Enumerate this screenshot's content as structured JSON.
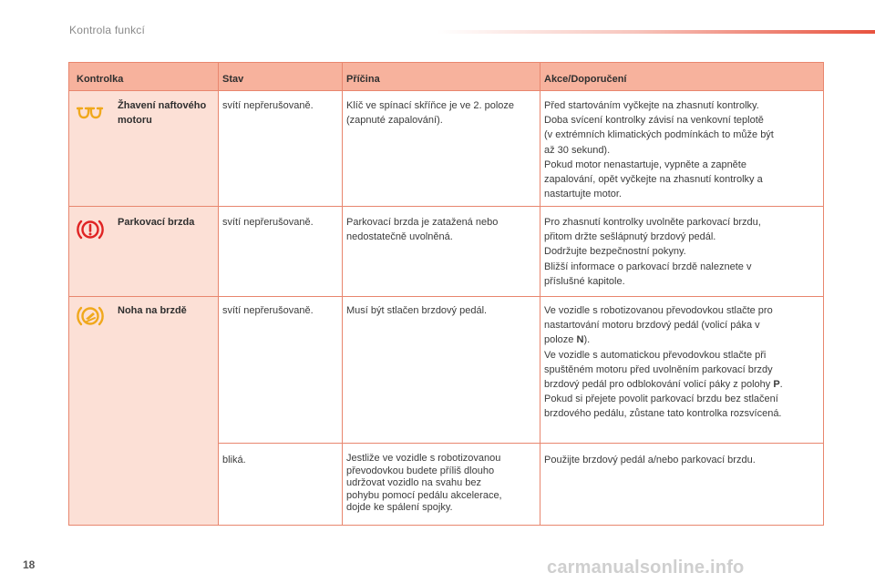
{
  "header": {
    "section_title": "Kontrola funkcí"
  },
  "table": {
    "headers": {
      "col1": "Kontrolka",
      "col2": "Stav",
      "col3": "Příčina",
      "col4": "Akce/Doporučení"
    },
    "rows": [
      {
        "icon": "glow-plug-icon",
        "name": "Žhavení naftového motoru",
        "state": "svítí nepřerušovaně.",
        "cause": "Klíč ve spínací skříňce je ve 2. poloze (zapnuté zapalování).",
        "action": [
          "Před startováním vyčkejte na zhasnutí kontrolky.",
          "Doba svícení kontrolky závisí na venkovní teplotě",
          "(v extrémních klimatických podmínkách to může být",
          "až 30 sekund).",
          "Pokud motor nenastartuje, vypněte a zapněte",
          "zapalování, opět vyčkejte na zhasnutí kontrolky a",
          "nastartujte motor."
        ]
      },
      {
        "icon": "parking-brake-icon",
        "name": "Parkovací brzda",
        "state": "svítí nepřerušovaně.",
        "cause": "Parkovací brzda je zatažená nebo nedostatečně uvolněná.",
        "action": [
          "Pro zhasnutí kontrolky uvolněte parkovací brzdu,",
          "přitom držte sešlápnutý brzdový pedál.",
          "Dodržujte bezpečnostní pokyny.",
          "Bližší informace o parkovací brzdě naleznete v",
          "příslušné kapitole."
        ]
      },
      {
        "icon": "foot-on-brake-icon",
        "name": "Noha na brzdě",
        "state": "svítí nepřerušovaně.",
        "cause": "Musí být stlačen brzdový pedál.",
        "action_parts": {
          "l1": "Ve vozidle s robotizovanou převodovkou stlačte pro",
          "l2": "nastartování motoru brzdový pedál (volicí páka v",
          "l3_pre": "poloze ",
          "l3_bold": "N",
          "l3_post": ").",
          "l4": "Ve vozidle s automatickou převodovkou stlačte při",
          "l5": "spuštěném motoru před uvolněním parkovací brzdy",
          "l6_pre": "brzdový pedál pro odblokování volicí páky z polohy ",
          "l6_bold": "P",
          "l6_post": ".",
          "l7": "Pokud si přejete povolit parkovací brzdu bez stlačení",
          "l8": "brzdového pedálu, zůstane tato kontrolka rozsvícená."
        }
      },
      {
        "state": "bliká.",
        "cause": [
          "Jestliže ve vozidle s robotizovanou",
          "převodovkou budete příliš dlouho",
          "udržovat vozidlo na svahu bez",
          "pohybu pomocí pedálu akcelerace,",
          "dojde ke spálení spojky."
        ],
        "action": "Použijte brzdový pedál a/nebo parkovací brzdu."
      }
    ]
  },
  "footer": {
    "page_number": "18",
    "watermark": "carmanualsonline.info"
  },
  "colors": {
    "header_bg": "#f7b29d",
    "first_col_bg": "#fce0d6",
    "border": "#e8866e",
    "icon_amber": "#f0a81c",
    "icon_red": "#e02424"
  }
}
